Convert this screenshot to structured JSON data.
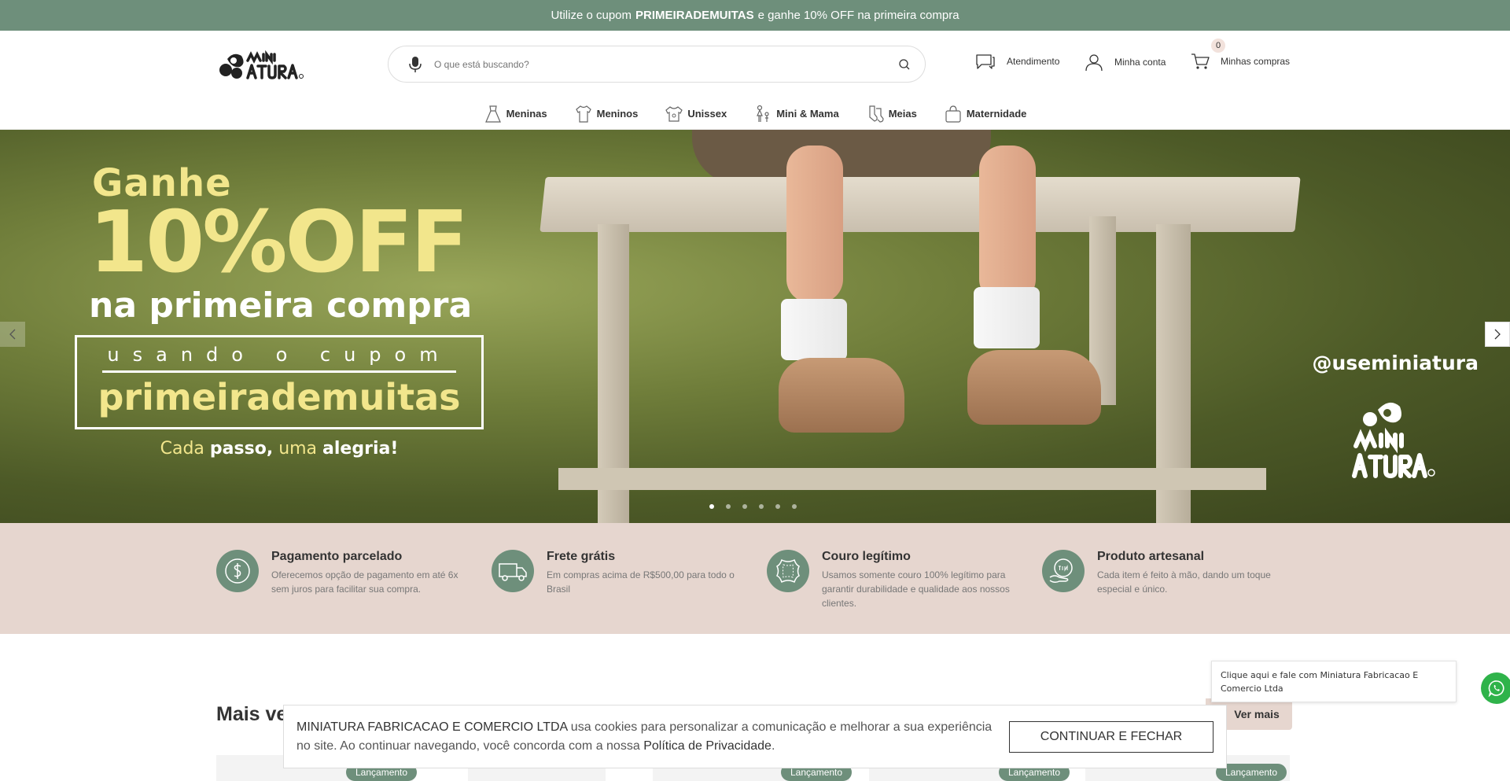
{
  "announcement": {
    "prefix": "Utilize o cupom",
    "code": "PRIMEIRADEMUITAS",
    "suffix": "e ganhe 10% OFF na primeira compra"
  },
  "header": {
    "search_placeholder": "O que está buscando?",
    "support_label": "Atendimento",
    "account_label": "Minha conta",
    "cart_label": "Minhas compras",
    "cart_count": "0"
  },
  "nav": {
    "items": [
      {
        "label": "Meninas",
        "icon": "dress-icon"
      },
      {
        "label": "Meninos",
        "icon": "shirt-icon"
      },
      {
        "label": "Unissex",
        "icon": "tshirt-icon"
      },
      {
        "label": "Mini & Mama",
        "icon": "mother-child-icon"
      },
      {
        "label": "Meias",
        "icon": "socks-icon"
      },
      {
        "label": "Maternidade",
        "icon": "baby-bag-icon"
      }
    ]
  },
  "hero": {
    "ganhe": "Ganhe",
    "off": "10%OFF",
    "primeira": "na primeira compra",
    "usando": "usando o cupom",
    "cupom": "primeirademuitas",
    "tag_1": "Cada",
    "tag_2": "passo,",
    "tag_3": "uma",
    "tag_4": "alegria!",
    "instagram": "@useminiatura",
    "slides_total": 6,
    "slide_active": 1
  },
  "benefits": [
    {
      "title": "Pagamento parcelado",
      "text": "Oferecemos opção de pagamento em até 6x sem juros para facilitar sua compra.",
      "icon": "dollar-icon"
    },
    {
      "title": "Frete grátis",
      "text": "Em compras acima de R$500,00 para todo o Brasil",
      "icon": "truck-icon"
    },
    {
      "title": "Couro legítimo",
      "text": "Usamos somente couro 100% legítimo para garantir durabilidade e qualidade aos nossos clientes.",
      "icon": "leather-icon"
    },
    {
      "title": "Produto artesanal",
      "text": "Cada item é feito à mão, dando um toque especial e único.",
      "icon": "handmade-icon"
    }
  ],
  "section": {
    "title": "Mais ve",
    "more_label": "Ver mais",
    "badge_label": "Lançamento"
  },
  "cookie": {
    "company": "MINIATURA FABRICACAO E COMERCIO LTDA",
    "text": "usa cookies para personalizar a comunicação e melhorar a sua experiência no site. Ao continuar navegando, você concorda com a nossa",
    "link": "Política de Privacidade",
    "end": ".",
    "button": "CONTINUAR E FECHAR"
  },
  "whatsapp": {
    "text": "Clique aqui e fale com Miniatura Fabricacao E Comercio Ltda"
  },
  "colors": {
    "brand_green": "#6e8f7b",
    "brand_beige": "#e6d6cf",
    "promo_yellow": "#f2e68c",
    "whatsapp": "#2fb34a"
  }
}
